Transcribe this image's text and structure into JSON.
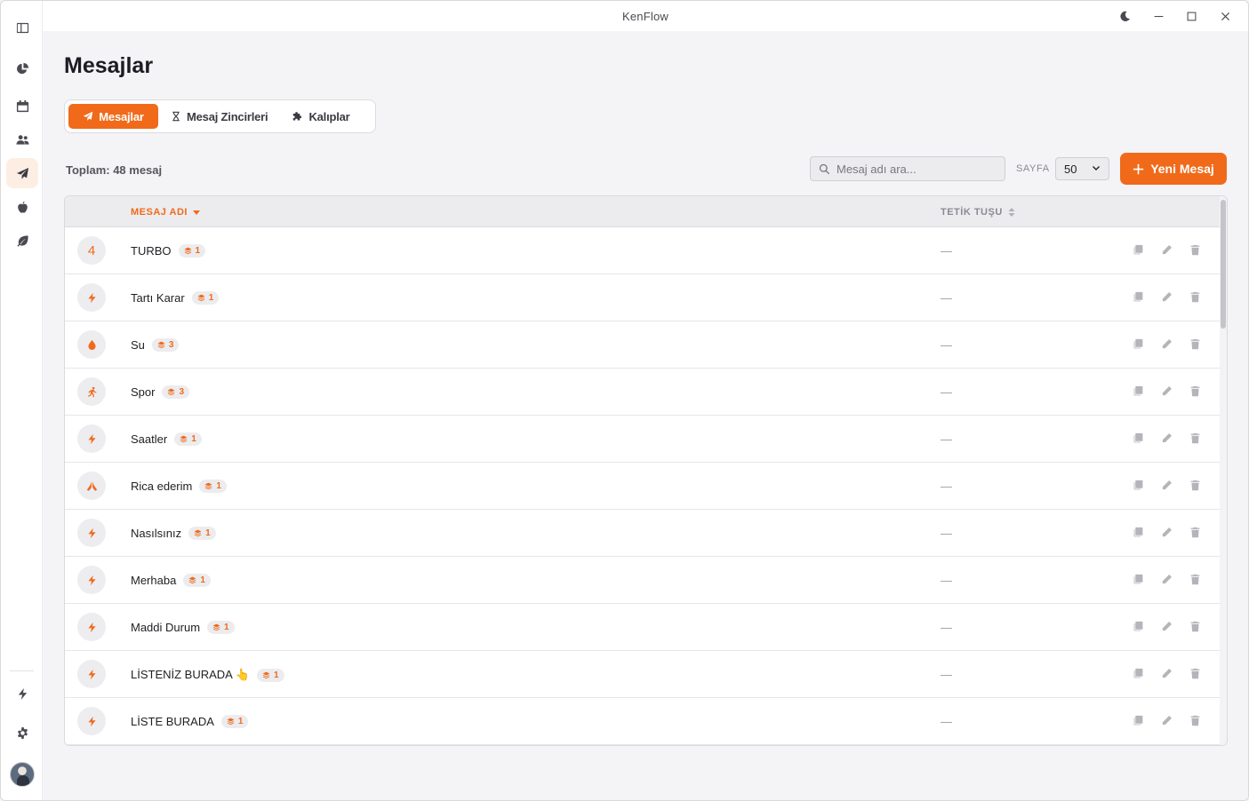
{
  "app": {
    "title": "KenFlow"
  },
  "sidebar": {
    "items": [
      {
        "icon": "sidebar-toggle-icon"
      },
      {
        "icon": "chart-pie-icon"
      },
      {
        "icon": "calendar-icon"
      },
      {
        "icon": "users-icon"
      },
      {
        "icon": "paper-plane-icon",
        "active": true
      },
      {
        "icon": "apple-icon"
      },
      {
        "icon": "leaf-icon"
      },
      {
        "icon": "bolt-icon"
      },
      {
        "icon": "gear-icon"
      }
    ]
  },
  "page": {
    "title": "Mesajlar",
    "tabs": [
      {
        "label": "Mesajlar",
        "icon": "paper-plane-icon",
        "active": true
      },
      {
        "label": "Mesaj Zincirleri",
        "icon": "hourglass-icon"
      },
      {
        "label": "Kalıplar",
        "icon": "puzzle-icon"
      }
    ],
    "total_label": "Toplam: 48 mesaj",
    "search_placeholder": "Mesaj adı ara...",
    "page_label": "SAYFA",
    "page_size": "50",
    "new_button": "Yeni Mesaj",
    "accent_color": "#f06a1a"
  },
  "table": {
    "columns": {
      "name": "MESAJ ADI",
      "trigger": "TETİK TUŞU"
    },
    "rows": [
      {
        "icon": "number-4-icon",
        "icon_text": "4",
        "name": "TURBO",
        "count": "1",
        "trigger": "—"
      },
      {
        "icon": "bolt-icon",
        "name": "Tartı Karar",
        "count": "1",
        "trigger": "—"
      },
      {
        "icon": "droplet-icon",
        "name": "Su",
        "count": "3",
        "trigger": "—"
      },
      {
        "icon": "running-icon",
        "name": "Spor",
        "count": "3",
        "trigger": "—"
      },
      {
        "icon": "bolt-icon",
        "name": "Saatler",
        "count": "1",
        "trigger": "—"
      },
      {
        "icon": "praying-hands-icon",
        "name": "Rica ederim",
        "count": "1",
        "trigger": "—"
      },
      {
        "icon": "bolt-icon",
        "name": "Nasılsınız",
        "count": "1",
        "trigger": "—"
      },
      {
        "icon": "bolt-icon",
        "name": "Merhaba",
        "count": "1",
        "trigger": "—"
      },
      {
        "icon": "bolt-icon",
        "name": "Maddi Durum",
        "count": "1",
        "trigger": "—"
      },
      {
        "icon": "bolt-icon",
        "name": "LİSTENİZ BURADA 👆",
        "count": "1",
        "trigger": "—"
      },
      {
        "icon": "bolt-icon",
        "name": "LİSTE BURADA",
        "count": "1",
        "trigger": "—"
      }
    ]
  }
}
